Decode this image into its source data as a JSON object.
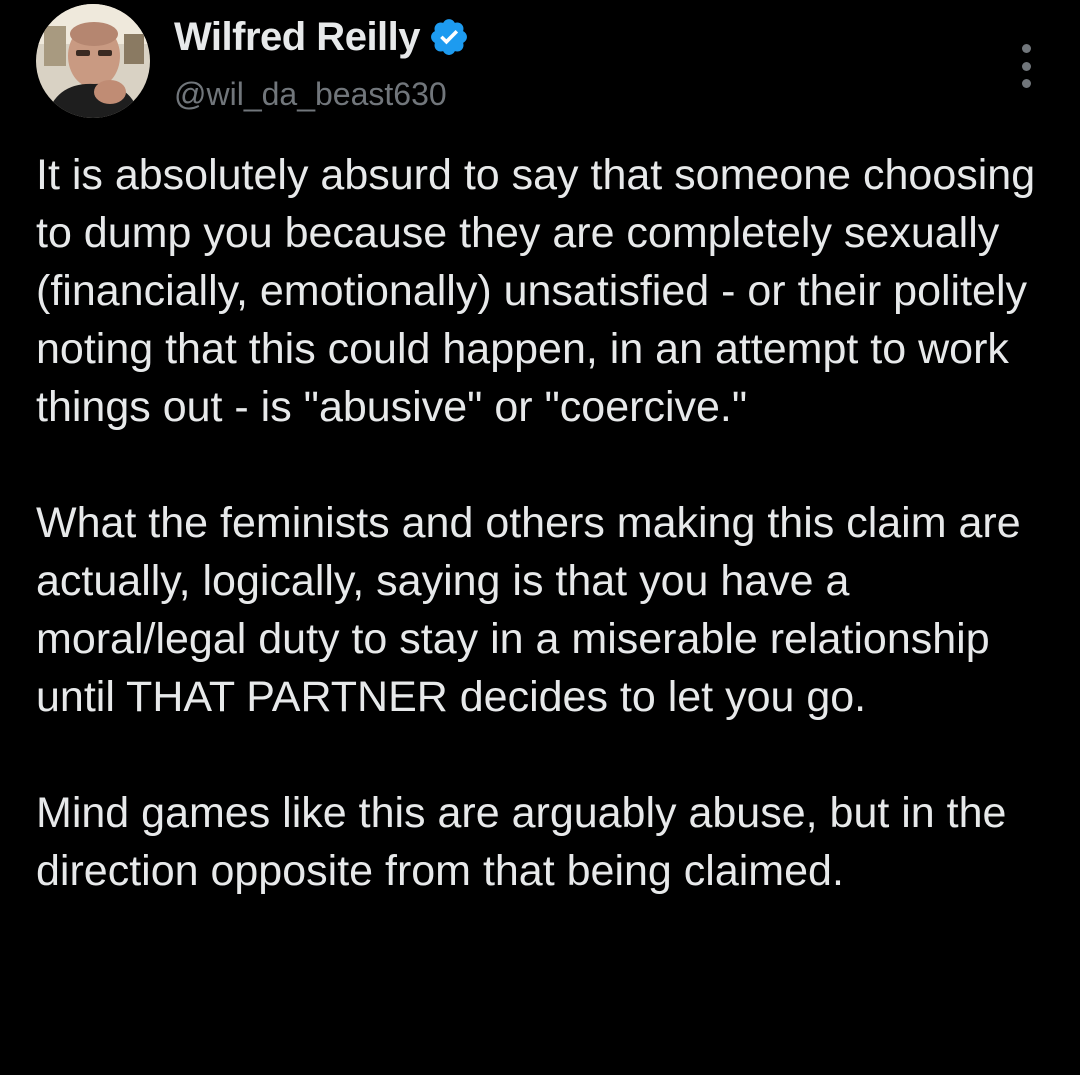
{
  "tweet": {
    "author": {
      "display_name": "Wilfred Reilly",
      "handle": "@wil_da_beast630",
      "verified": true,
      "avatar_icon": "profile-photo",
      "verified_icon": "verified-badge-icon",
      "more_icon": "more-options-icon"
    },
    "paragraphs": [
      "It is absolutely absurd to say that someone choosing to dump you because they are completely sexually (financially, emotionally) unsatisfied - or their politely noting that this could happen, in an attempt to work things out - is \"abusive\" or \"coercive.\"",
      "What the feminists and others making this claim are actually, logically, saying is that you have a moral/legal duty to stay in a miserable relationship until THAT PARTNER decides to let you go.",
      "Mind games like this are arguably abuse, but in the direction opposite from that being claimed."
    ]
  },
  "colors": {
    "background": "#000000",
    "text_primary": "#e7e9ea",
    "text_secondary": "#71767b",
    "verified_blue": "#1d9bf0"
  }
}
